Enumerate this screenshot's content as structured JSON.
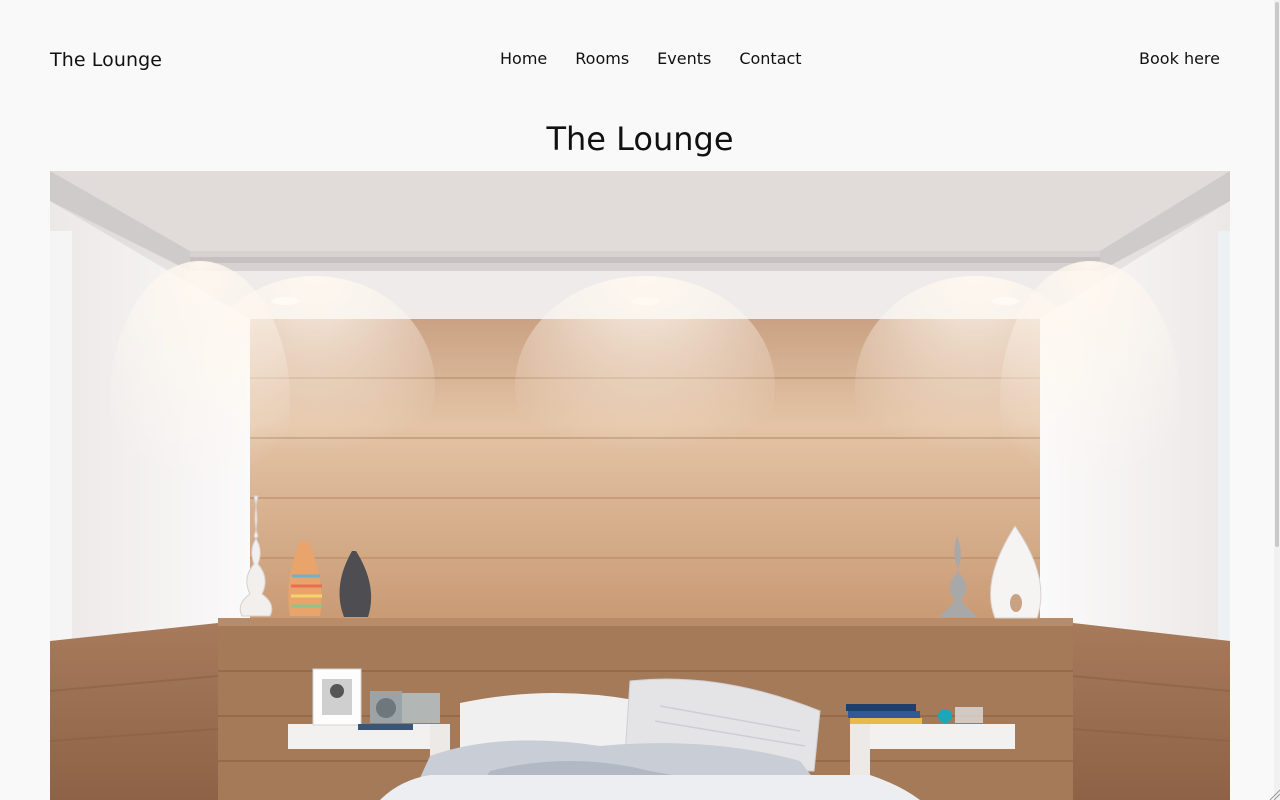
{
  "header": {
    "brand": "The Lounge",
    "nav": [
      "Home",
      "Rooms",
      "Events",
      "Contact"
    ],
    "cta": "Book here"
  },
  "main": {
    "title": "The Lounge",
    "hero": {
      "subject": "bedroom-interior-photo"
    }
  }
}
